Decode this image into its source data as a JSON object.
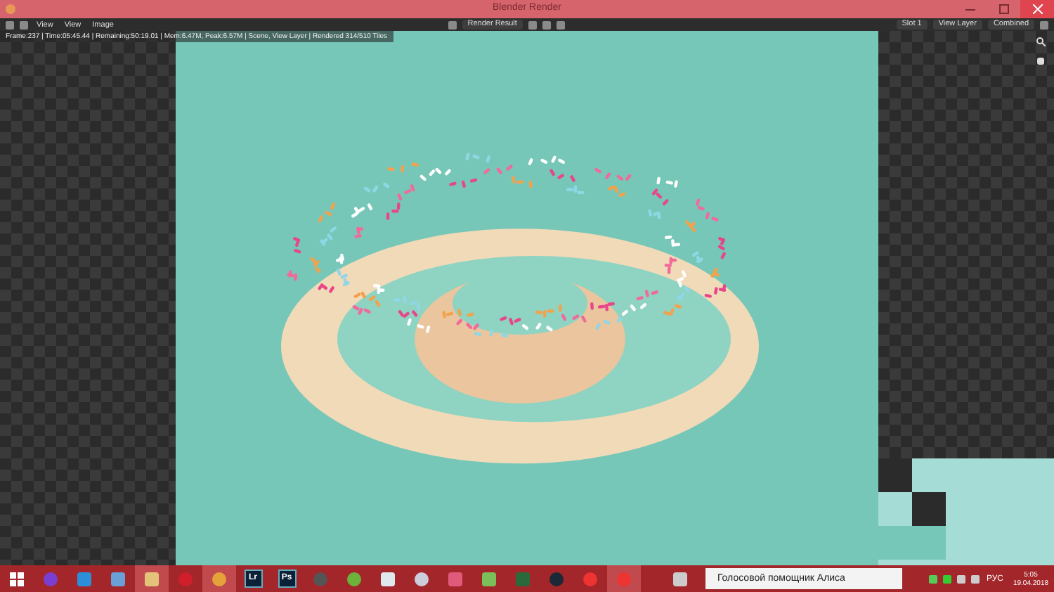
{
  "window": {
    "title": "Blender Render"
  },
  "header": {
    "menus": [
      "View",
      "View",
      "Image"
    ],
    "image_name": "Render Result",
    "slot": "Slot 1",
    "layer": "View Layer",
    "pass": "Combined"
  },
  "stats": "Frame:237 | Time:05:45.44 | Remaining:50:19.01 | Mem:6.47M, Peak:6.57M | Scene, View Layer | Rendered 314/510 Tiles",
  "taskbar": {
    "apps": [
      {
        "label": "Lr"
      },
      {
        "label": "Ps"
      }
    ],
    "search": {
      "placeholder": "Голосовой помощник Алиса"
    },
    "language": "РУС",
    "time": "5:05",
    "date": "19.04.2018"
  }
}
